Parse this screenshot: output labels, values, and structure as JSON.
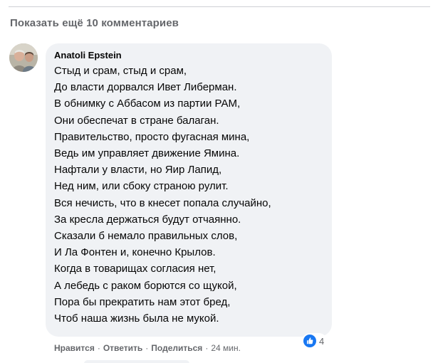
{
  "show_more_label": "Показать ещё 10 комментариев",
  "comment": {
    "author": "Anatoli Epstein",
    "lines": [
      "Стыд и срам, стыд и срам,",
      "До власти дорвался Ивет Либерман.",
      "В обнимку с Аббасом из партии РАМ,",
      "Они обеспечат в стране балаган.",
      "Правительство, просто фугасная мина,",
      "Ведь им управляет движение Ямина.",
      "Нафтали у власти, но Яир Лапид,",
      "Нед ним, или сбоку страною рулит.",
      "Вся нечисть, что в кнесет попала случайно,",
      "За кресла держаться будут отчаянно.",
      "Сказали б немало правильных слов,",
      "И Ла Фонтен и, конечно Крылов.",
      "Когда в товарищах согласия нет,",
      "А лебедь с раком борются со щукой,",
      "Пора бы прекратить нам этот бред,",
      "Чтоб наша жизнь была не мукой."
    ],
    "reaction_icon": "like-icon",
    "reaction_count": "4",
    "actions": {
      "like": "Нравится",
      "reply": "Ответить",
      "share": "Поделиться",
      "time": "24 мин."
    },
    "separator": "·"
  },
  "colors": {
    "bubble": "#f0f2f5",
    "secondary_text": "#65676b",
    "primary_text": "#050505",
    "like_blue": "#1877f2"
  }
}
